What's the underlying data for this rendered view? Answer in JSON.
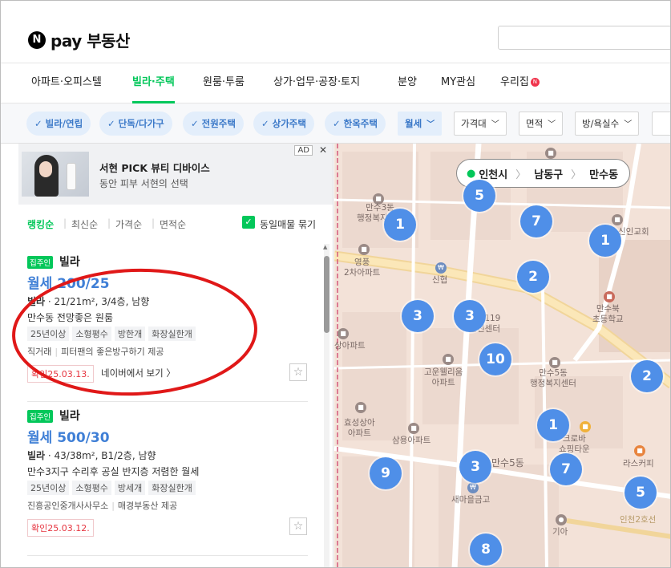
{
  "header": {
    "logo_letter": "N",
    "logo_text": "pay 부동산"
  },
  "nav": {
    "items": [
      "아파트·오피스텔",
      "빌라·주택",
      "원룸·투룸",
      "상가·업무·공장·토지",
      "분양",
      "MY관심",
      "우리집"
    ],
    "active": "빌라·주택",
    "badge": "N"
  },
  "filters": {
    "chips": [
      "빌라/연립",
      "단독/다가구",
      "전원주택",
      "상가주택",
      "한옥주택"
    ],
    "dropdowns": [
      "월세",
      "가격대",
      "면적",
      "방/욕실수"
    ]
  },
  "ad": {
    "title": "서현 PICK 뷰티 디바이스",
    "subtitle": "동안 피부 서현의 선택",
    "badge": "AD",
    "close": "✕"
  },
  "sort": {
    "options": [
      "랭킹순",
      "최신순",
      "가격순",
      "면적순"
    ],
    "active": "랭킹순",
    "same_label": "동일매물 묶기"
  },
  "listings": [
    {
      "badge": "집주인",
      "type": "빌라",
      "price": "월세 200/25",
      "spec_type": "빌라",
      "spec": " · 21/21m², 3/4층, 남향",
      "desc": "만수동 전망좋은 원룸",
      "tags": [
        "25년이상",
        "소형평수",
        "방한개",
        "화장실한개"
      ],
      "agent": "직거래",
      "agent_note": "피터팬의 좋은방구하기 제공",
      "confirm": "확인25.03.13.",
      "view_link": "네이버에서 보기 〉"
    },
    {
      "badge": "집주인",
      "type": "빌라",
      "price": "월세 500/30",
      "spec_type": "빌라",
      "spec": " · 43/38m², B1/2층, 남향",
      "desc": "만수3지구 수리후 공실 반지층 저렴한 월세",
      "tags": [
        "25년이상",
        "소형평수",
        "방세개",
        "화장실한개"
      ],
      "agent": "진흥공인중개사사무소",
      "agent_note": "매경부동산 제공",
      "confirm": "확인25.03.12.",
      "view_link": ""
    }
  ],
  "map": {
    "breadcrumb": [
      "인천시",
      "남동구",
      "만수동"
    ],
    "clusters": [
      "5",
      "1",
      "7",
      "1",
      "2",
      "3",
      "3",
      "10",
      "2",
      "1",
      "7",
      "3",
      "9",
      "5",
      "8"
    ],
    "pois": {
      "p1": "만수3동\n행정복지센터",
      "p2": "영풍\n2차아파트",
      "p3": "신협",
      "p4": "만수119\n안전센터",
      "p5": "만수북\n초등학교",
      "p6": "고운웰리움\n아파트",
      "p7": "만수5동\n행정복지센터",
      "p8": "효성상아\n아파트",
      "p9": "삼용아파트",
      "p10": "크로바\n쇼핑타운",
      "p11": "만수5동",
      "p12": "새마을금고",
      "p13": "기아",
      "p14": "라스커피",
      "p15": "인천2호선",
      "p16": "신인교회",
      "p17": "상아파트"
    }
  }
}
